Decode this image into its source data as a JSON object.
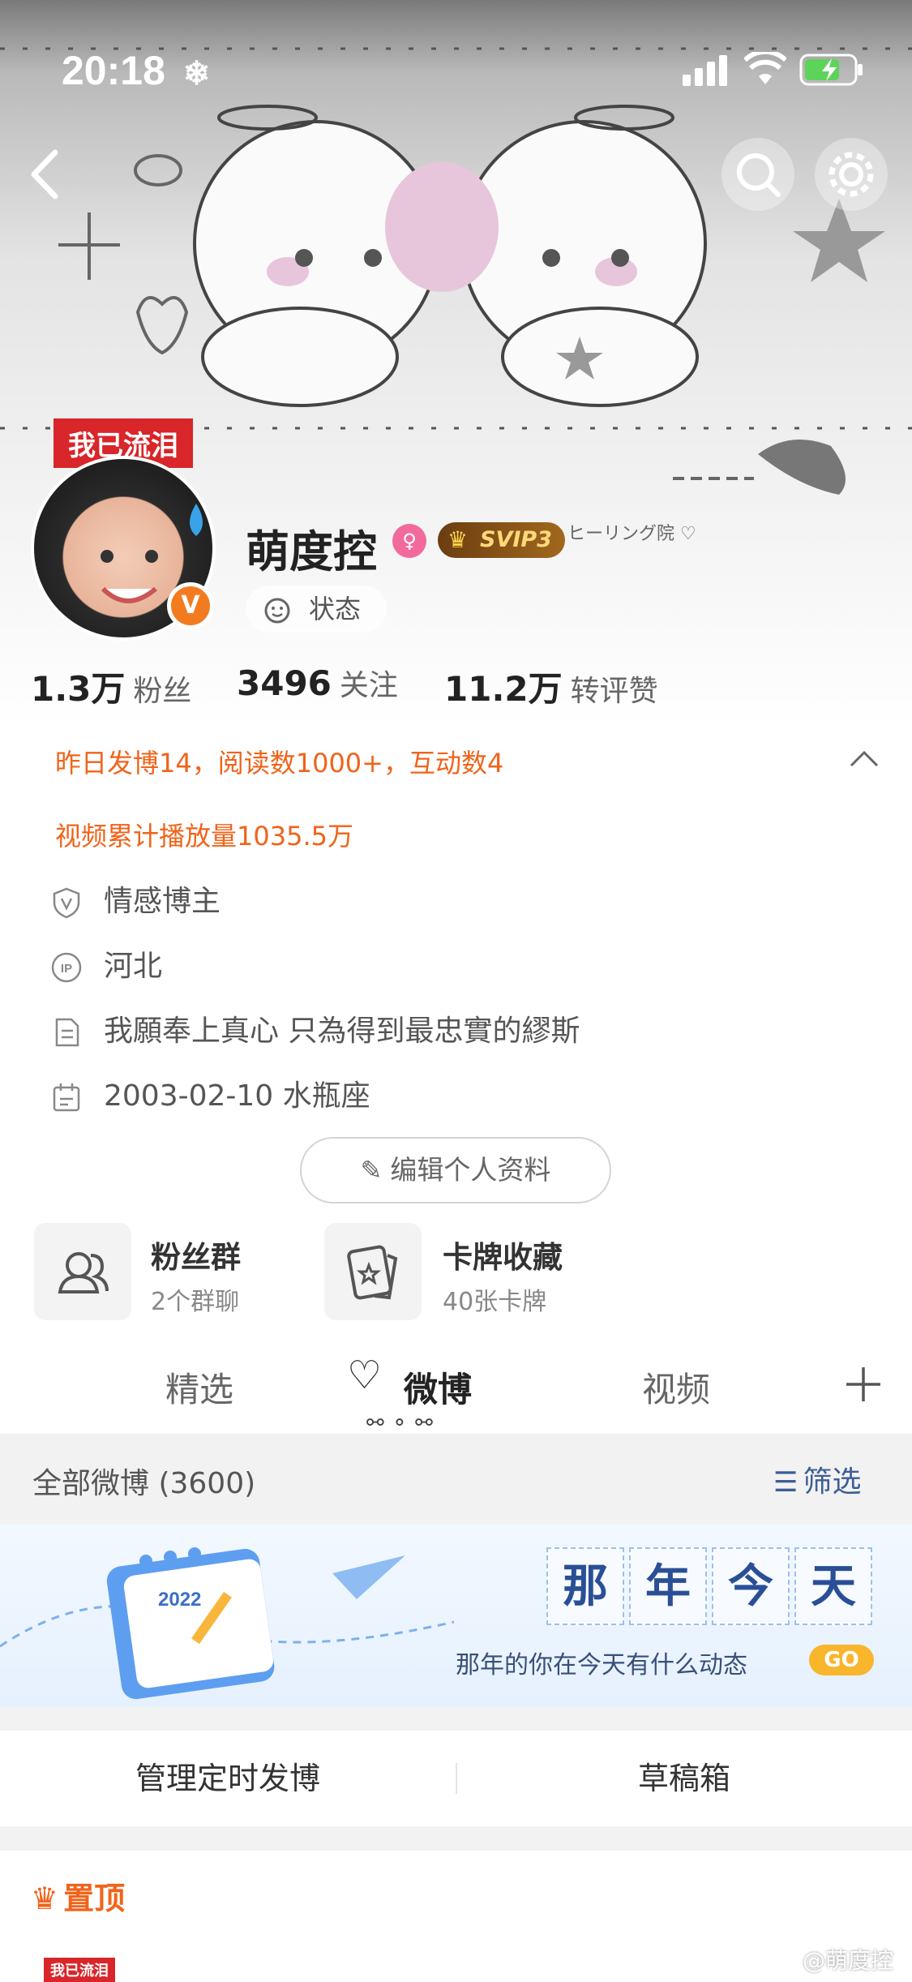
{
  "status_bar": {
    "time": "20:18",
    "time_icon": "snowflake-icon"
  },
  "header": {
    "back_icon": "chevron-left-icon",
    "search_icon": "search-icon",
    "settings_icon": "gear-icon",
    "cover_sticker": "ヒーリング院 ♡"
  },
  "profile": {
    "tag": "我已流泪",
    "name": "萌度控",
    "gender_icon": "female-icon",
    "vip": "SVIP3",
    "status_label": "状态",
    "verify_badge": "V"
  },
  "stats": [
    {
      "num": "1.3万",
      "label": "粉丝"
    },
    {
      "num": "3496",
      "label": "关注"
    },
    {
      "num": "11.2万",
      "label": "转评赞"
    }
  ],
  "summary": {
    "line1": "昨日发博14，阅读数1000+，互动数4",
    "line2": "视频累计播放量1035.5万"
  },
  "info": [
    {
      "icon": "shield-icon",
      "text": "情感博主"
    },
    {
      "icon": "ip-icon",
      "text": "河北"
    },
    {
      "icon": "document-icon",
      "text": "我願奉上真心 只為得到最忠實的繆斯"
    },
    {
      "icon": "calendar-icon",
      "text": "2003-02-10 水瓶座"
    }
  ],
  "edit_button": "编辑个人资料",
  "cards": [
    {
      "icon": "group-icon",
      "title": "粉丝群",
      "sub": "2个群聊"
    },
    {
      "icon": "card-icon",
      "title": "卡牌收藏",
      "sub": "40张卡牌"
    }
  ],
  "tabs": [
    "精选",
    "微博",
    "视频"
  ],
  "tab_add_icon": "plus-icon",
  "feed": {
    "title": "全部微博 (3600)",
    "filter": "筛选"
  },
  "memory": {
    "chars": [
      "那",
      "年",
      "今",
      "天"
    ],
    "subtitle": "那年的你在今天有什么动态",
    "go": "GO",
    "calendar_year": "2022"
  },
  "manage": [
    "管理定时发博",
    "草稿箱"
  ],
  "pinned": {
    "label": "置顶",
    "tag": "我已流泪"
  },
  "watermark": "@萌度控",
  "colors": {
    "accent": "#f0631a",
    "tag_red": "#d8262a",
    "vip_gold": "#ffd97a"
  }
}
